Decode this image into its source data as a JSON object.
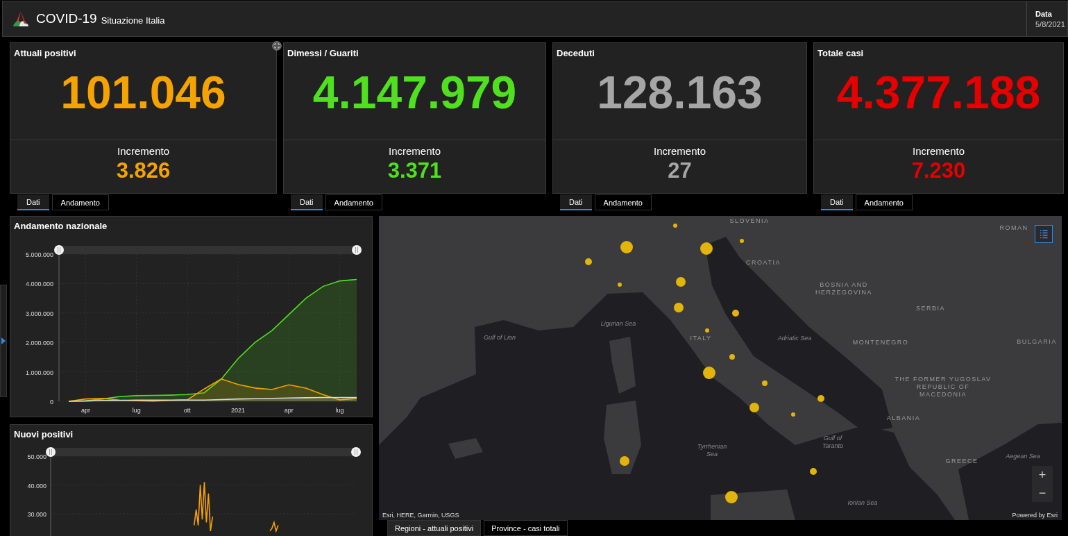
{
  "header": {
    "title": "COVID-19",
    "subtitle": "Situazione Italia",
    "date_label": "Data",
    "date": "5/8/2021"
  },
  "cards": [
    {
      "title": "Attuali positivi",
      "value": "101.046",
      "increment_label": "Incremento",
      "increment": "3.826",
      "color": "#f5a300",
      "tabs": [
        {
          "label": "Dati",
          "selected": true
        },
        {
          "label": "Andamento",
          "selected": false
        }
      ]
    },
    {
      "title": "Dimessi / Guariti",
      "value": "4.147.979",
      "increment_label": "Incremento",
      "increment": "3.371",
      "color": "#4fe01e",
      "tabs": [
        {
          "label": "Dati",
          "selected": true
        },
        {
          "label": "Andamento",
          "selected": false
        }
      ]
    },
    {
      "title": "Deceduti",
      "value": "128.163",
      "increment_label": "Incremento",
      "increment": "27",
      "color": "#a6a6a6",
      "tabs": [
        {
          "label": "Dati",
          "selected": true
        },
        {
          "label": "Andamento",
          "selected": false
        }
      ]
    },
    {
      "title": "Totale casi",
      "value": "4.377.188",
      "increment_label": "Incremento",
      "increment": "7.230",
      "color": "#e60000",
      "tabs": [
        {
          "label": "Dati",
          "selected": true
        },
        {
          "label": "Andamento",
          "selected": false
        }
      ]
    }
  ],
  "trend_panel": {
    "title": "Andamento nazionale",
    "chart_data": {
      "type": "area",
      "grid": true,
      "ylim": [
        0,
        5000000
      ],
      "categories": [
        null,
        "apr",
        null,
        null,
        "lug",
        null,
        null,
        "ott",
        null,
        null,
        "2021",
        null,
        null,
        "apr",
        null,
        null,
        "lug",
        null
      ],
      "yticks": [
        {
          "value": 0,
          "label": "0"
        },
        {
          "value": 1000000,
          "label": "1.000.000"
        },
        {
          "value": 2000000,
          "label": "2.000.000"
        },
        {
          "value": 3000000,
          "label": "3.000.000"
        },
        {
          "value": 4000000,
          "label": "4.000.000"
        },
        {
          "value": 5000000,
          "label": "5.000.000"
        }
      ],
      "series": [
        {
          "color": "#4fe01e",
          "values": [
            0,
            20000,
            80000,
            160000,
            190000,
            200000,
            210000,
            230000,
            290000,
            750000,
            1450000,
            2000000,
            2400000,
            2950000,
            3500000,
            3900000,
            4090000,
            4140000
          ]
        },
        {
          "color": "#f5a300",
          "values": [
            0,
            80000,
            100000,
            40000,
            20000,
            10000,
            30000,
            50000,
            420000,
            760000,
            570000,
            450000,
            400000,
            560000,
            450000,
            230000,
            50000,
            100000
          ]
        },
        {
          "color": "#d8d8d8",
          "values": [
            0,
            10000,
            30000,
            30000,
            40000,
            40000,
            40000,
            40000,
            40000,
            60000,
            80000,
            90000,
            100000,
            110000,
            120000,
            130000,
            130000,
            130000
          ]
        }
      ]
    }
  },
  "new_cases_panel": {
    "title": "Nuovi positivi",
    "chart_data": {
      "type": "line",
      "grid": true,
      "ylim": [
        0,
        50000
      ],
      "yticks": [
        {
          "value": 30000,
          "label": "30.000"
        },
        {
          "value": 40000,
          "label": "40.000"
        },
        {
          "value": 50000,
          "label": "50.000"
        }
      ],
      "categories": [
        null,
        null,
        null,
        null,
        null,
        null,
        null,
        null,
        null,
        null,
        null,
        null,
        null,
        null,
        null,
        null,
        null,
        null,
        null,
        null,
        null,
        null,
        null,
        null,
        null,
        null,
        null,
        null,
        null,
        null,
        null,
        null,
        null,
        null,
        null,
        null,
        null,
        null,
        null,
        null,
        null,
        null,
        null,
        null,
        null,
        null,
        null,
        null,
        null,
        null,
        null,
        null,
        null,
        null,
        null,
        null,
        null,
        null,
        null,
        null,
        null,
        null,
        null,
        null,
        null,
        null,
        null,
        null,
        null,
        null,
        null,
        null,
        null,
        null,
        null,
        null,
        null,
        null,
        null,
        null,
        null,
        null,
        null,
        null,
        null,
        null,
        null,
        null,
        null,
        null,
        null,
        null,
        null,
        null,
        null,
        null,
        null,
        null,
        null,
        null,
        null,
        null,
        null,
        null,
        null,
        null,
        null,
        null,
        null,
        null,
        null,
        null,
        null,
        null,
        null,
        null,
        null,
        null,
        null,
        null,
        null,
        null,
        null,
        null,
        null,
        null,
        null,
        null,
        null,
        null,
        null,
        null,
        null,
        null,
        null,
        null,
        null,
        null,
        null,
        null,
        null,
        null,
        null,
        null,
        null,
        null,
        null,
        null,
        null,
        null
      ],
      "series": [
        {
          "color": "#f5a300",
          "values": [
            null,
            null,
            null,
            null,
            null,
            null,
            null,
            null,
            null,
            null,
            null,
            null,
            null,
            null,
            null,
            null,
            null,
            null,
            null,
            null,
            null,
            null,
            null,
            null,
            null,
            null,
            null,
            null,
            null,
            null,
            null,
            null,
            null,
            null,
            null,
            null,
            null,
            null,
            null,
            null,
            null,
            null,
            null,
            null,
            null,
            null,
            null,
            null,
            null,
            null,
            null,
            null,
            null,
            null,
            null,
            null,
            null,
            null,
            null,
            null,
            null,
            null,
            null,
            null,
            null,
            null,
            null,
            null,
            null,
            null,
            26000,
            31500,
            26000,
            40000,
            28000,
            41000,
            27000,
            37000,
            24000,
            29000,
            null,
            null,
            null,
            null,
            null,
            null,
            null,
            null,
            null,
            null,
            null,
            null,
            null,
            null,
            null,
            null,
            null,
            null,
            null,
            null,
            null,
            null,
            null,
            null,
            null,
            null,
            null,
            24000,
            25000,
            27000,
            24000,
            26000,
            null,
            null,
            null,
            null,
            null,
            null,
            null,
            null,
            null,
            null,
            null,
            null,
            null,
            null,
            null,
            null,
            null,
            null,
            null,
            null,
            null,
            null,
            null,
            null,
            null,
            null,
            null,
            null,
            null,
            null,
            null,
            null,
            null,
            null,
            null,
            null,
            null,
            null
          ]
        }
      ]
    }
  },
  "map": {
    "labels": [
      {
        "text": "SLOVENIA",
        "kind": "country"
      },
      {
        "text": "ROMAN",
        "kind": "country"
      },
      {
        "text": "CROATIA",
        "kind": "country"
      },
      {
        "text": "BOSNIA AND\nHERZEGOVINA",
        "kind": "country"
      },
      {
        "text": "SERBIA",
        "kind": "country"
      },
      {
        "text": "BULGARIA",
        "kind": "country"
      },
      {
        "text": "MONTENEGRO",
        "kind": "country"
      },
      {
        "text": "THE FORMER YUGOSLAV\nREPUBLIC OF\nMACEDONIA",
        "kind": "country"
      },
      {
        "text": "ALBANIA",
        "kind": "country"
      },
      {
        "text": "GREECE",
        "kind": "country"
      },
      {
        "text": "ITALY",
        "kind": "country"
      },
      {
        "text": "Ligurian Sea",
        "kind": "sea"
      },
      {
        "text": "Gulf of Lion",
        "kind": "sea"
      },
      {
        "text": "Adriatic Sea",
        "kind": "sea"
      },
      {
        "text": "Tyrrhenian\nSea",
        "kind": "sea"
      },
      {
        "text": "Gulf of\nTaranto",
        "kind": "sea"
      },
      {
        "text": "Ionian Sea",
        "kind": "sea"
      },
      {
        "text": "Aegean Sea",
        "kind": "sea"
      }
    ],
    "zoom_in": "+",
    "zoom_out": "−",
    "attribution": "Esri, HERE, Garmin, USGS",
    "powered_by": "Powered by Esri",
    "layer_tabs": [
      {
        "label": "Regioni - attuali positivi",
        "selected": true
      },
      {
        "label": "Province - casi totali",
        "selected": false
      }
    ]
  }
}
